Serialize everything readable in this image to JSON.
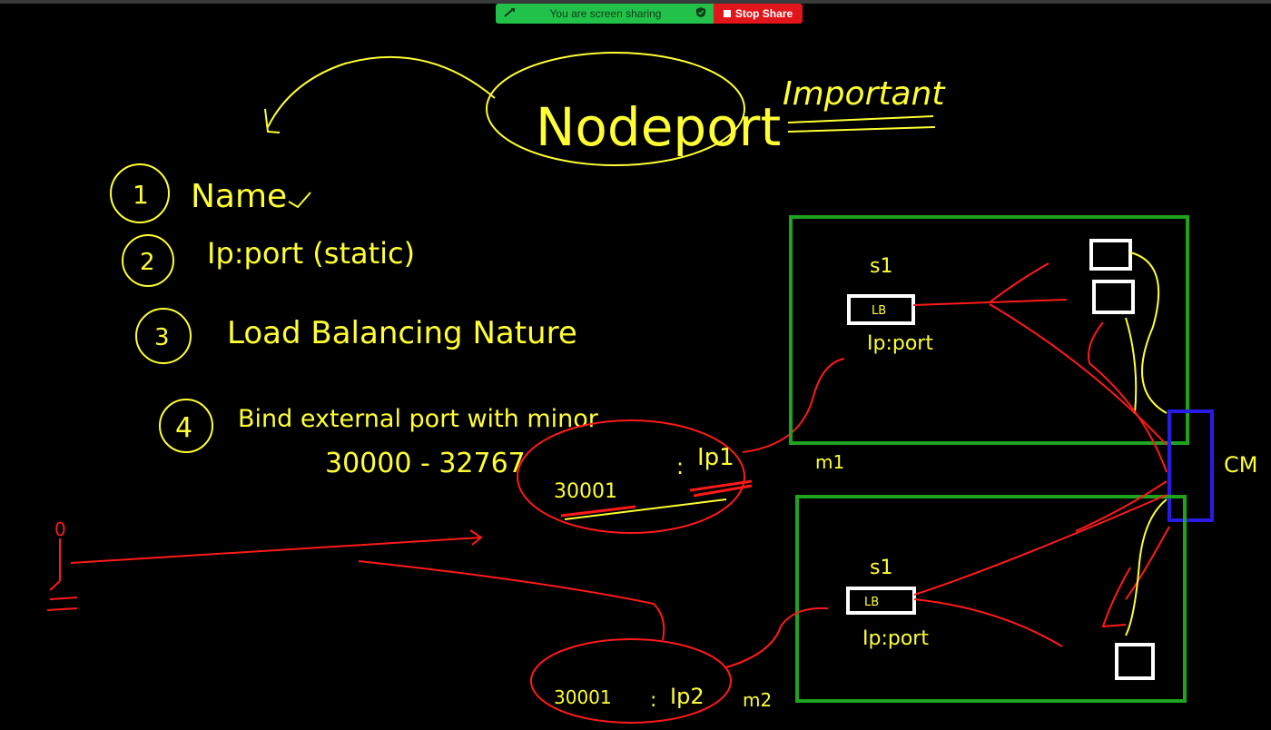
{
  "share_bar": {
    "status_text": "You are screen sharing",
    "stop_label": "Stop Share",
    "status_color": "#22c24a",
    "stop_color": "#e0161b",
    "icons": [
      "pen-icon",
      "shield-check-icon",
      "stop-square-icon"
    ]
  },
  "whiteboard": {
    "colors": {
      "yellow": "#ffff33",
      "red": "#ff1a1a",
      "green": "#1fa31f",
      "blue": "#2a1ae6",
      "white": "#ffffff"
    },
    "title": "Nodeport",
    "note": "Important",
    "points": [
      {
        "num": "1",
        "text": "Name"
      },
      {
        "num": "2",
        "text": "Ip:port (static)"
      },
      {
        "num": "3",
        "text": "Load Balancing Nature"
      },
      {
        "num": "4",
        "text": "Bind external port with minor"
      }
    ],
    "port_range": "30000 - 32767",
    "mapping_m1": {
      "port": "30001",
      "sep": ":",
      "ip": "Ip1"
    },
    "mapping_m2": {
      "port": "30001",
      "sep": ":",
      "ip": "Ip2"
    },
    "node_labels": {
      "m1": "m1",
      "m2": "m2"
    },
    "service_labels": {
      "s1_top": "s1",
      "s1_bottom": "s1"
    },
    "lb_labels": {
      "top": "LB",
      "bottom": "LB"
    },
    "ipport_labels": {
      "top": "Ip:port",
      "bottom": "Ip:port"
    },
    "cm_label": "CM",
    "user_label": "0"
  }
}
